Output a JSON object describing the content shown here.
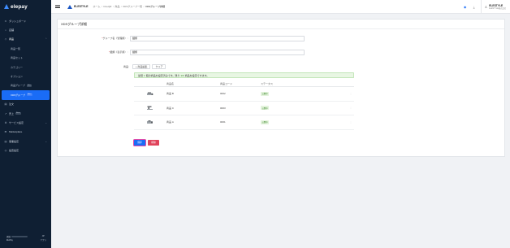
{
  "sidebar": {
    "logo": "elepay",
    "items": [
      {
        "label": "ダッシュボード",
        "icon": "dashboard-icon"
      },
      {
        "label": "店舗",
        "icon": "store-icon"
      },
      {
        "label": "商品",
        "icon": "product-icon"
      }
    ],
    "product_sub": [
      {
        "label": "商品一覧"
      },
      {
        "label": "商品セット"
      },
      {
        "label": "カテゴリー"
      },
      {
        "label": "オプション"
      },
      {
        "label": "商品グループ",
        "badge": "Beta"
      },
      {
        "label": "XDSグループ",
        "badge": "Beta",
        "active": true
      }
    ],
    "items2": [
      {
        "label": "注文",
        "icon": "order-icon"
      },
      {
        "label": "売上",
        "icon": "sales-icon",
        "badge": "Beta"
      },
      {
        "label": "サービス設定",
        "icon": "service-icon",
        "chevron": true
      },
      {
        "label": "Marketplace",
        "icon": "marketplace-icon"
      },
      {
        "label": "事業設定",
        "icon": "business-icon",
        "chevron": true
      },
      {
        "label": "設置設定",
        "icon": "install-icon"
      }
    ],
    "footer": {
      "left_top": "環境",
      "left_bottom": "ElePay",
      "right_top": "JP",
      "right_bottom": "アプリ"
    }
  },
  "topbar": {
    "brand": "ELESTYLE",
    "breadcrumbs": [
      "ホーム",
      "OneQR",
      "商品",
      "XDSグループ一覧",
      "XDSグループ詳細"
    ],
    "user_name": "ELESTYLE",
    "user_sub": "ELESTYLE株式会社"
  },
  "page": {
    "title": "XDSグループ詳細",
    "group_name_label": "グループ名（管理用）",
    "group_name_value": "麺類",
    "display_name_label": "麺類（表示用）",
    "display_name_value": "麺類",
    "products_label": "商品:",
    "add_products_button": "+ 商品編集",
    "clear_button": "クリア",
    "alert_prefix": "最低",
    "alert_min": "1",
    "alert_mid": "個の商品を設定済みです。残り",
    "alert_remaining": "1/3",
    "alert_suffix": "商品を設定できます。",
    "table_headers": [
      "",
      "商品名",
      "商品コード",
      "ステータス",
      ""
    ],
    "rows": [
      {
        "name": "商品 B",
        "code": "0002",
        "status": "公開中"
      },
      {
        "name": "商品 C",
        "code": "0003",
        "status": "公開中"
      },
      {
        "name": "商品 A",
        "code": "0001",
        "status": "公開中"
      }
    ],
    "save_button": "保存",
    "delete_button": "削除"
  },
  "colors": {
    "sidebar_bg": "#0f1f33",
    "accent": "#1a6cf6",
    "danger": "#e0445b",
    "success_bg": "#e8f6e3"
  }
}
